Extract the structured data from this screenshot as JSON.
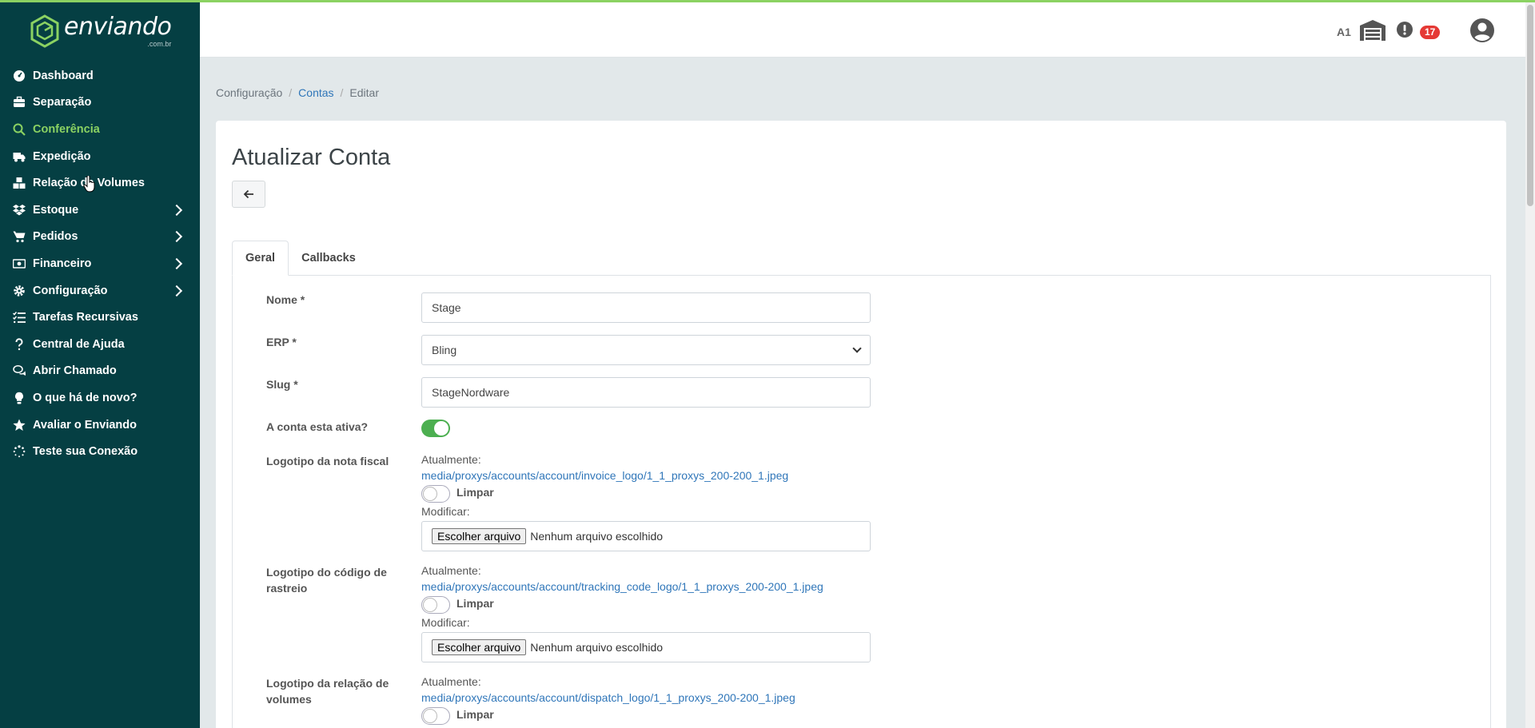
{
  "brand": {
    "name": "enviando",
    "sub": ".com.br"
  },
  "sidebar": {
    "items": [
      {
        "label": "Dashboard",
        "icon": "gauge-icon"
      },
      {
        "label": "Separação",
        "icon": "briefcase-icon"
      },
      {
        "label": "Conferência",
        "icon": "search-icon",
        "active": true
      },
      {
        "label": "Expedição",
        "icon": "truck-icon"
      },
      {
        "label": "Relação de Volumes",
        "icon": "boxes-icon"
      },
      {
        "label": "Estoque",
        "icon": "dropbox-icon",
        "submenu": true
      },
      {
        "label": "Pedidos",
        "icon": "cart-icon",
        "submenu": true
      },
      {
        "label": "Financeiro",
        "icon": "money-icon",
        "submenu": true
      },
      {
        "label": "Configuração",
        "icon": "gear-icon",
        "submenu": true
      },
      {
        "label": "Tarefas Recursivas",
        "icon": "tasks-icon"
      },
      {
        "label": "Central de Ajuda",
        "icon": "question-icon"
      },
      {
        "label": "Abrir Chamado",
        "icon": "chat-icon"
      },
      {
        "label": "O que há de novo?",
        "icon": "lightbulb-icon"
      },
      {
        "label": "Avaliar o Enviando",
        "icon": "star-icon"
      },
      {
        "label": "Teste sua Conexão",
        "icon": "spinner-icon"
      }
    ]
  },
  "header": {
    "account_code": "A1",
    "notification_count": "17"
  },
  "breadcrumb": {
    "level1": "Configuração",
    "level2": "Contas",
    "level3": "Editar",
    "separator": "/"
  },
  "page": {
    "title": "Atualizar Conta",
    "back_icon": "arrow-left-icon"
  },
  "tabs": [
    {
      "label": "Geral",
      "active": true
    },
    {
      "label": "Callbacks"
    }
  ],
  "form": {
    "nome": {
      "label": "Nome *",
      "value": "Stage"
    },
    "erp": {
      "label": "ERP *",
      "value": "Bling"
    },
    "slug": {
      "label": "Slug *",
      "value": "StageNordware"
    },
    "ativa": {
      "label": "A conta esta ativa?",
      "checked": true
    },
    "logo_nf": {
      "label": "Logotipo da nota fiscal",
      "current_label": "Atualmente:",
      "current_file": "media/proxys/accounts/account/invoice_logo/1_1_proxys_200-200_1.jpeg",
      "clear_label": "Limpar",
      "modify_label": "Modificar:",
      "button": "Escolher arquivo",
      "no_file": "Nenhum arquivo escolhido"
    },
    "logo_rastreio": {
      "label": "Logotipo do código de rastreio",
      "current_label": "Atualmente:",
      "current_file": "media/proxys/accounts/account/tracking_code_logo/1_1_proxys_200-200_1.jpeg",
      "clear_label": "Limpar",
      "modify_label": "Modificar:",
      "button": "Escolher arquivo",
      "no_file": "Nenhum arquivo escolhido"
    },
    "logo_volumes": {
      "label": "Logotipo da relação de volumes",
      "current_label": "Atualmente:",
      "current_file": "media/proxys/accounts/account/dispatch_logo/1_1_proxys_200-200_1.jpeg",
      "clear_label": "Limpar"
    }
  },
  "colors": {
    "sidebar_bg": "#053f43",
    "accent": "#8bd262",
    "link": "#2f76b9",
    "toggle_on": "#4caf50",
    "badge": "#e53935"
  }
}
